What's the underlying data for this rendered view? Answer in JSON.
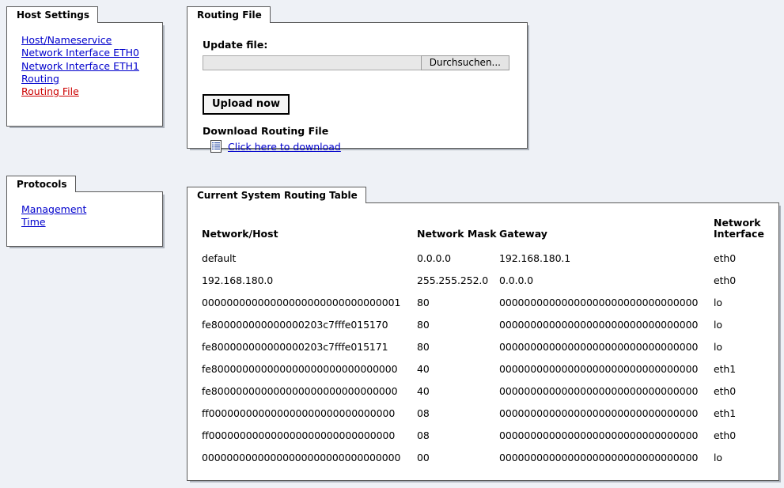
{
  "sidebar": {
    "host_settings": {
      "tab_label": "Host Settings",
      "items": [
        {
          "label": "Host/Nameservice",
          "active": false
        },
        {
          "label": "Network Interface ETH0",
          "active": false
        },
        {
          "label": "Network Interface ETH1",
          "active": false
        },
        {
          "label": "Routing",
          "active": false
        },
        {
          "label": "Routing File",
          "active": true
        }
      ]
    },
    "protocols": {
      "tab_label": "Protocols",
      "items": [
        {
          "label": "Management",
          "active": false
        },
        {
          "label": "Time",
          "active": false
        }
      ]
    }
  },
  "routing_file": {
    "tab_label": "Routing File",
    "update_label": "Update file:",
    "file_value": "",
    "file_placeholder": "",
    "browse_label": "Durchsuchen...",
    "upload_label": "Upload now",
    "download_title": "Download Routing File",
    "download_link": "Click here to download",
    "download_icon": "document-icon"
  },
  "routing_table": {
    "tab_label": "Current System Routing Table",
    "columns": [
      "Network/Host",
      "Network Mask",
      "Gateway",
      "Network Interface"
    ],
    "rows": [
      {
        "host": "default",
        "mask": "0.0.0.0",
        "gateway": "192.168.180.1",
        "interface": "eth0"
      },
      {
        "host": "192.168.180.0",
        "mask": "255.255.252.0",
        "gateway": "0.0.0.0",
        "interface": "eth0"
      },
      {
        "host": "00000000000000000000000000000001",
        "mask": "80",
        "gateway": "00000000000000000000000000000000",
        "interface": "lo"
      },
      {
        "host": "fe800000000000000203c7fffe015170",
        "mask": "80",
        "gateway": "00000000000000000000000000000000",
        "interface": "lo"
      },
      {
        "host": "fe800000000000000203c7fffe015171",
        "mask": "80",
        "gateway": "00000000000000000000000000000000",
        "interface": "lo"
      },
      {
        "host": "fe800000000000000000000000000000",
        "mask": "40",
        "gateway": "00000000000000000000000000000000",
        "interface": "eth1"
      },
      {
        "host": "fe800000000000000000000000000000",
        "mask": "40",
        "gateway": "00000000000000000000000000000000",
        "interface": "eth0"
      },
      {
        "host": "ff000000000000000000000000000000",
        "mask": "08",
        "gateway": "00000000000000000000000000000000",
        "interface": "eth1"
      },
      {
        "host": "ff000000000000000000000000000000",
        "mask": "08",
        "gateway": "00000000000000000000000000000000",
        "interface": "eth0"
      },
      {
        "host": "00000000000000000000000000000000",
        "mask": "00",
        "gateway": "00000000000000000000000000000000",
        "interface": "lo"
      }
    ]
  },
  "colors": {
    "page_background": "#eef1f6",
    "panel_background": "#ffffff",
    "border": "#5a5a5a",
    "link": "#0000cc",
    "link_active": "#cc0000"
  }
}
